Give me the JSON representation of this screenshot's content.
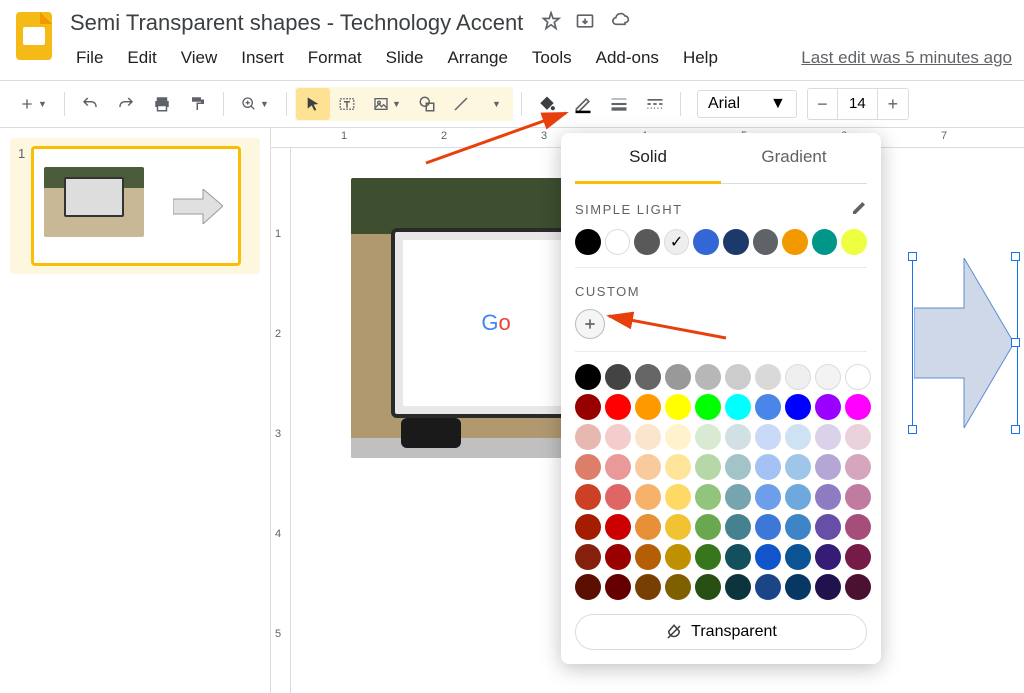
{
  "document": {
    "title": "Semi Transparent shapes - Technology Accent",
    "last_edit": "Last edit was 5 minutes ago"
  },
  "menu": {
    "file": "File",
    "edit": "Edit",
    "view": "View",
    "insert": "Insert",
    "format": "Format",
    "slide": "Slide",
    "arrange": "Arrange",
    "tools": "Tools",
    "addons": "Add-ons",
    "help": "Help"
  },
  "toolbar": {
    "font_family": "Arial",
    "font_size": "14"
  },
  "ruler": {
    "h": [
      "1",
      "2",
      "3",
      "4",
      "5",
      "6",
      "7"
    ],
    "v": [
      "1",
      "2",
      "3",
      "4",
      "5"
    ]
  },
  "thumbnails": {
    "slide1_index": "1"
  },
  "color_picker": {
    "tab_solid": "Solid",
    "tab_gradient": "Gradient",
    "section_simple_light": "SIMPLE LIGHT",
    "section_custom": "CUSTOM",
    "transparent_label": "Transparent",
    "theme_colors": [
      "#000000",
      "#ffffff",
      "#595959",
      "#eeeeee",
      "#3367d6",
      "#1b3a6b",
      "#5f6368",
      "#f29900",
      "#009688",
      "#eeff41"
    ],
    "theme_selected_index": 3,
    "palette": [
      [
        "#000000",
        "#434343",
        "#666666",
        "#999999",
        "#b7b7b7",
        "#cccccc",
        "#d9d9d9",
        "#efefef",
        "#f3f3f3",
        "#ffffff"
      ],
      [
        "#980000",
        "#ff0000",
        "#ff9900",
        "#ffff00",
        "#00ff00",
        "#00ffff",
        "#4a86e8",
        "#0000ff",
        "#9900ff",
        "#ff00ff"
      ],
      [
        "#e6b8af",
        "#f4cccc",
        "#fce5cd",
        "#fff2cc",
        "#d9ead3",
        "#d0e0e3",
        "#c9daf8",
        "#cfe2f3",
        "#d9d2e9",
        "#ead1dc"
      ],
      [
        "#dd7e6b",
        "#ea9999",
        "#f9cb9c",
        "#ffe599",
        "#b6d7a8",
        "#a2c4c9",
        "#a4c2f4",
        "#9fc5e8",
        "#b4a7d6",
        "#d5a6bd"
      ],
      [
        "#cc4125",
        "#e06666",
        "#f6b26b",
        "#ffd966",
        "#93c47d",
        "#76a5af",
        "#6d9eeb",
        "#6fa8dc",
        "#8e7cc3",
        "#c27ba0"
      ],
      [
        "#a61c00",
        "#cc0000",
        "#e69138",
        "#f1c232",
        "#6aa84f",
        "#45818e",
        "#3c78d8",
        "#3d85c6",
        "#674ea7",
        "#a64d79"
      ],
      [
        "#85200c",
        "#990000",
        "#b45f06",
        "#bf9000",
        "#38761d",
        "#134f5c",
        "#1155cc",
        "#0b5394",
        "#351c75",
        "#741b47"
      ],
      [
        "#5b0f00",
        "#660000",
        "#783f04",
        "#7f6000",
        "#274e13",
        "#0c343d",
        "#1c4587",
        "#073763",
        "#20124d",
        "#4c1130"
      ]
    ]
  },
  "canvas_image": {
    "search_text": "Go"
  }
}
